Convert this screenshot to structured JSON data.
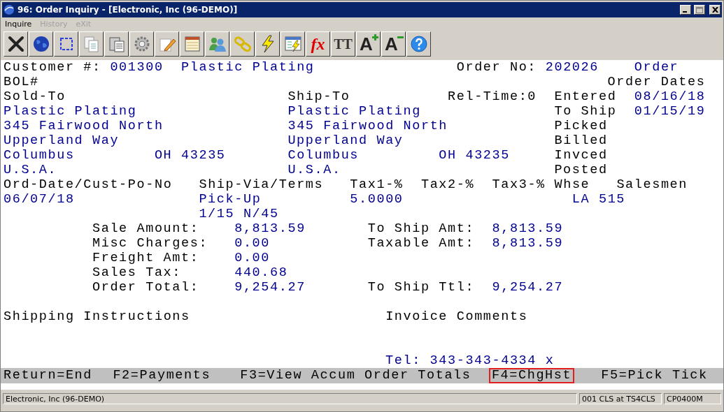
{
  "window": {
    "title": "96: Order Inquiry - [Electronic, Inc (96-DEMO)]"
  },
  "menu": [
    {
      "label": "Inquire",
      "disabled": false
    },
    {
      "label": "History",
      "disabled": true
    },
    {
      "label": "eXit",
      "disabled": true
    }
  ],
  "toolbar": [
    {
      "kind": "icon"
    },
    {
      "kind": "icon"
    },
    {
      "kind": "icon"
    },
    {
      "kind": "icon"
    },
    {
      "kind": "icon"
    },
    {
      "kind": "icon"
    },
    {
      "kind": "icon"
    },
    {
      "kind": "icon"
    },
    {
      "kind": "icon"
    },
    {
      "kind": "icon"
    },
    {
      "kind": "icon"
    },
    {
      "kind": "icon"
    },
    {
      "kind": "glyph",
      "glyph": "fx"
    },
    {
      "kind": "glyph",
      "glyph": "TT"
    },
    {
      "kind": "glyph",
      "glyph": "A"
    },
    {
      "kind": "glyph",
      "glyph": "A"
    },
    {
      "kind": "icon"
    }
  ],
  "terminal": {
    "lines": [
      {
        "fields": [
          {
            "kind": "label",
            "text": "Customer #:"
          },
          {
            "kind": "value",
            "text": "001300"
          },
          {
            "kind": "value",
            "text": "Plastic Plating"
          },
          {
            "kind": "label",
            "text": "Order No:"
          },
          {
            "kind": "value",
            "text": "202026"
          },
          {
            "kind": "value",
            "text": "Order"
          }
        ]
      },
      {
        "fields": [
          {
            "kind": "label",
            "text": "BOL#"
          },
          {
            "kind": "label",
            "text": "Order Dates"
          }
        ]
      },
      {
        "fields": [
          {
            "kind": "label",
            "text": "Sold-To"
          },
          {
            "kind": "label",
            "text": "Ship-To"
          },
          {
            "kind": "label",
            "text": "Rel-Time:0"
          },
          {
            "kind": "label",
            "text": "Entered"
          },
          {
            "kind": "value",
            "text": "08/16/18"
          }
        ]
      },
      {
        "fields": [
          {
            "kind": "value",
            "text": "Plastic Plating"
          },
          {
            "kind": "value",
            "text": "Plastic Plating"
          },
          {
            "kind": "label",
            "text": "To Ship"
          },
          {
            "kind": "value",
            "text": "01/15/19"
          }
        ]
      },
      {
        "fields": [
          {
            "kind": "value",
            "text": "345 Fairwood North"
          },
          {
            "kind": "value",
            "text": "345 Fairwood North"
          },
          {
            "kind": "label",
            "text": "Picked"
          }
        ]
      },
      {
        "fields": [
          {
            "kind": "value",
            "text": "Upperland Way"
          },
          {
            "kind": "value",
            "text": "Upperland Way"
          },
          {
            "kind": "label",
            "text": "Billed"
          }
        ]
      },
      {
        "fields": [
          {
            "kind": "value",
            "text": "Columbus"
          },
          {
            "kind": "value",
            "text": "OH 43235"
          },
          {
            "kind": "value",
            "text": "Columbus"
          },
          {
            "kind": "value",
            "text": "OH 43235"
          },
          {
            "kind": "label",
            "text": "Invced"
          }
        ]
      },
      {
        "fields": [
          {
            "kind": "value",
            "text": "U.S.A."
          },
          {
            "kind": "value",
            "text": "U.S.A."
          },
          {
            "kind": "label",
            "text": "Posted"
          }
        ]
      },
      {
        "fields": [
          {
            "kind": "label",
            "text": "Ord-Date/Cust-Po-No"
          },
          {
            "kind": "label",
            "text": "Ship-Via/Terms"
          },
          {
            "kind": "label",
            "text": "Tax1-%"
          },
          {
            "kind": "label",
            "text": "Tax2-%"
          },
          {
            "kind": "label",
            "text": "Tax3-%"
          },
          {
            "kind": "label",
            "text": "Whse"
          },
          {
            "kind": "label",
            "text": "Salesmen"
          }
        ]
      },
      {
        "fields": [
          {
            "kind": "value",
            "text": "06/07/18"
          },
          {
            "kind": "value",
            "text": "Pick-Up"
          },
          {
            "kind": "value",
            "text": "5.0000"
          },
          {
            "kind": "value",
            "text": "LA 515"
          }
        ]
      },
      {
        "fields": [
          {
            "kind": "value",
            "text": "1/15 N/45"
          }
        ]
      },
      {
        "fields": [
          {
            "kind": "label",
            "text": "Sale Amount:"
          },
          {
            "kind": "value",
            "text": "8,813.59"
          },
          {
            "kind": "label",
            "text": "To Ship Amt:"
          },
          {
            "kind": "value",
            "text": "8,813.59"
          }
        ]
      },
      {
        "fields": [
          {
            "kind": "label",
            "text": "Misc Charges:"
          },
          {
            "kind": "value",
            "text": "0.00"
          },
          {
            "kind": "label",
            "text": "Taxable Amt:"
          },
          {
            "kind": "value",
            "text": "8,813.59"
          }
        ]
      },
      {
        "fields": [
          {
            "kind": "label",
            "text": "Freight Amt:"
          },
          {
            "kind": "value",
            "text": "0.00"
          }
        ]
      },
      {
        "fields": [
          {
            "kind": "label",
            "text": "Sales Tax:"
          },
          {
            "kind": "value",
            "text": "440.68"
          }
        ]
      },
      {
        "fields": [
          {
            "kind": "label",
            "text": "Order Total:"
          },
          {
            "kind": "value",
            "text": "9,254.27"
          },
          {
            "kind": "label",
            "text": "To Ship Ttl:"
          },
          {
            "kind": "value",
            "text": "9,254.27"
          }
        ]
      },
      {
        "fields": [
          {
            "kind": "label",
            "text": "Shipping Instructions"
          },
          {
            "kind": "label",
            "text": "Invoice Comments"
          }
        ]
      },
      {
        "fields": [
          {
            "kind": "value",
            "text": "Tel: 343-343-4334 x"
          }
        ]
      }
    ]
  },
  "function_keys": [
    {
      "text": "Return=End",
      "highlighted": false
    },
    {
      "text": "F2=Payments",
      "highlighted": false
    },
    {
      "text": "F3=View Accum Order Totals",
      "highlighted": false
    },
    {
      "text": "F4=ChgHst",
      "highlighted": true
    },
    {
      "text": "F5=Pick Tick",
      "highlighted": false
    }
  ],
  "status_bar": [
    "Electronic, Inc (96-DEMO)",
    "001 CLS at TS4CLS",
    "CP0400M"
  ]
}
